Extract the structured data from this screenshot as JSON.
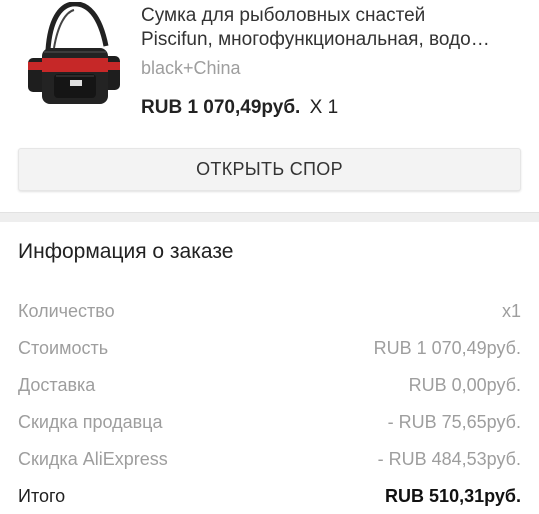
{
  "product": {
    "image_icon": "fishing-waist-bag-image",
    "title_line1": "Сумка для рыболовных снастей",
    "title_line2": "Piscifun, многофункциональная, водо…",
    "variant": "black+China",
    "price": "RUB 1 070,49руб.",
    "quantity": "X 1"
  },
  "dispute_button": {
    "label": "ОТКРЫТЬ СПОР"
  },
  "order_info": {
    "title": "Информация о заказе",
    "rows": [
      {
        "label": "Количество",
        "value": "x1"
      },
      {
        "label": "Стоимость",
        "value": "RUB 1 070,49руб."
      },
      {
        "label": "Доставка",
        "value": "RUB 0,00руб."
      },
      {
        "label": "Скидка продавца",
        "value": "- RUB 75,65руб."
      },
      {
        "label": "Скидка AliExpress",
        "value": "- RUB 484,53руб."
      }
    ],
    "total": {
      "label": "Итого",
      "value": "RUB 510,31руб."
    }
  },
  "colors": {
    "bag_body": "#1c1c1c",
    "bag_accent": "#d32f2f",
    "muted_text": "#9e9e9e",
    "divider": "#eeeeee"
  }
}
